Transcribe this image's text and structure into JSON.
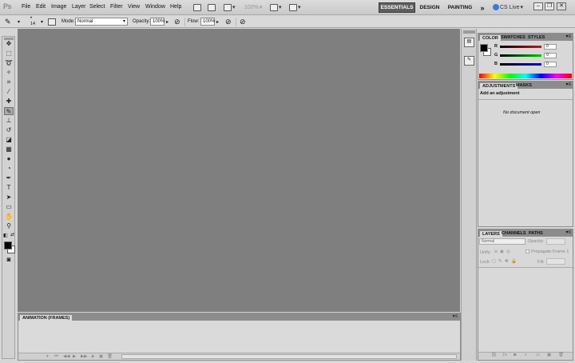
{
  "app": {
    "logo": "Ps"
  },
  "menu": [
    "File",
    "Edit",
    "Image",
    "Layer",
    "Select",
    "Filter",
    "View",
    "Window",
    "Help"
  ],
  "menubar_extras": {
    "zoom": "100%"
  },
  "workspaces": [
    "ESSENTIALS",
    "DESIGN",
    "PAINTING"
  ],
  "more_workspaces": "»",
  "cs_live": "CS Live",
  "window_buttons": {
    "minimize": "–",
    "restore": "❐",
    "close": "✕"
  },
  "options": {
    "brush_size": "14",
    "mode_label": "Mode:",
    "mode_value": "Normal",
    "opacity_label": "Opacity:",
    "opacity_value": "100%",
    "flow_label": "Flow:",
    "flow_value": "100%"
  },
  "color_panel": {
    "tabs": [
      "COLOR",
      "SWATCHES",
      "STYLES"
    ],
    "channels": [
      {
        "label": "R",
        "value": "0"
      },
      {
        "label": "G",
        "value": "0"
      },
      {
        "label": "B",
        "value": "0"
      }
    ]
  },
  "adjustments_panel": {
    "tabs": [
      "ADJUSTMENTS",
      "MASKS"
    ],
    "heading": "Add an adjustment",
    "message": "No document open"
  },
  "layers_panel": {
    "tabs": [
      "LAYERS",
      "CHANNELS",
      "PATHS"
    ],
    "blend_mode": "Normal",
    "opacity_label": "Opacity:",
    "unify_label": "Unify:",
    "propagate_label": "Propagate Frame 1",
    "lock_label": "Lock:",
    "fill_label": "Fill:"
  },
  "animation_panel": {
    "tab": "ANIMATION (FRAMES)"
  }
}
